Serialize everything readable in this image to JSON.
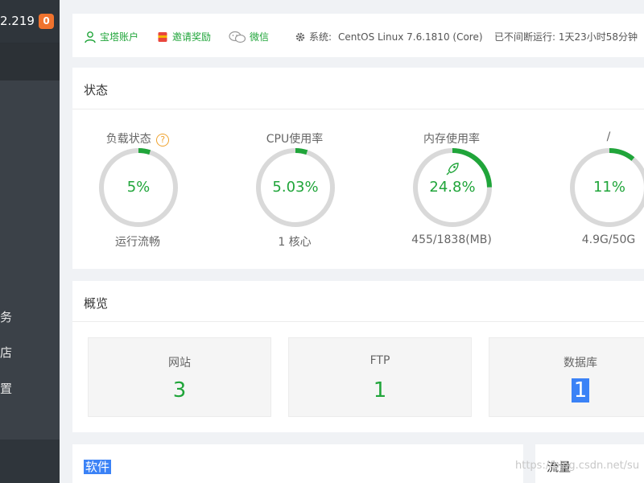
{
  "sidebar": {
    "ip_fragment": "2.219",
    "badge_count": "0",
    "items": [
      "务",
      "店",
      "置"
    ]
  },
  "topbar": {
    "account": "宝塔账户",
    "invite": "邀请奖励",
    "wechat": "微信",
    "system_label": "系统:",
    "system_value": "CentOS Linux 7.6.1810 (Core)",
    "uptime": "已不间断运行: 1天23小时58分钟"
  },
  "status": {
    "title": "状态",
    "gauges": [
      {
        "label": "负载状态",
        "value": "5%",
        "percent": 5,
        "foot": "运行流畅",
        "has_help": true
      },
      {
        "label": "CPU使用率",
        "value": "5.03%",
        "percent": 5.03,
        "foot": "1 核心",
        "has_help": false
      },
      {
        "label": "内存使用率",
        "value": "24.8%",
        "percent": 24.8,
        "foot": "455/1838(MB)",
        "has_help": false,
        "icon": "rocket-icon"
      },
      {
        "label": "/",
        "value": "11%",
        "percent": 11,
        "foot": "4.9G/50G",
        "has_help": false
      }
    ]
  },
  "overview": {
    "title": "概览",
    "items": [
      {
        "label": "网站",
        "value": "3"
      },
      {
        "label": "FTP",
        "value": "1"
      },
      {
        "label": "数据库",
        "value": "1"
      }
    ]
  },
  "software": {
    "title": "软件"
  },
  "flow": {
    "title": "流量"
  },
  "watermark": "https://blog.csdn.net/su",
  "colors": {
    "accent": "#20a53a",
    "track": "#d9d9d9",
    "sidebar": "#3b4148",
    "badge": "#f0732e",
    "selection": "#3b82f6"
  }
}
